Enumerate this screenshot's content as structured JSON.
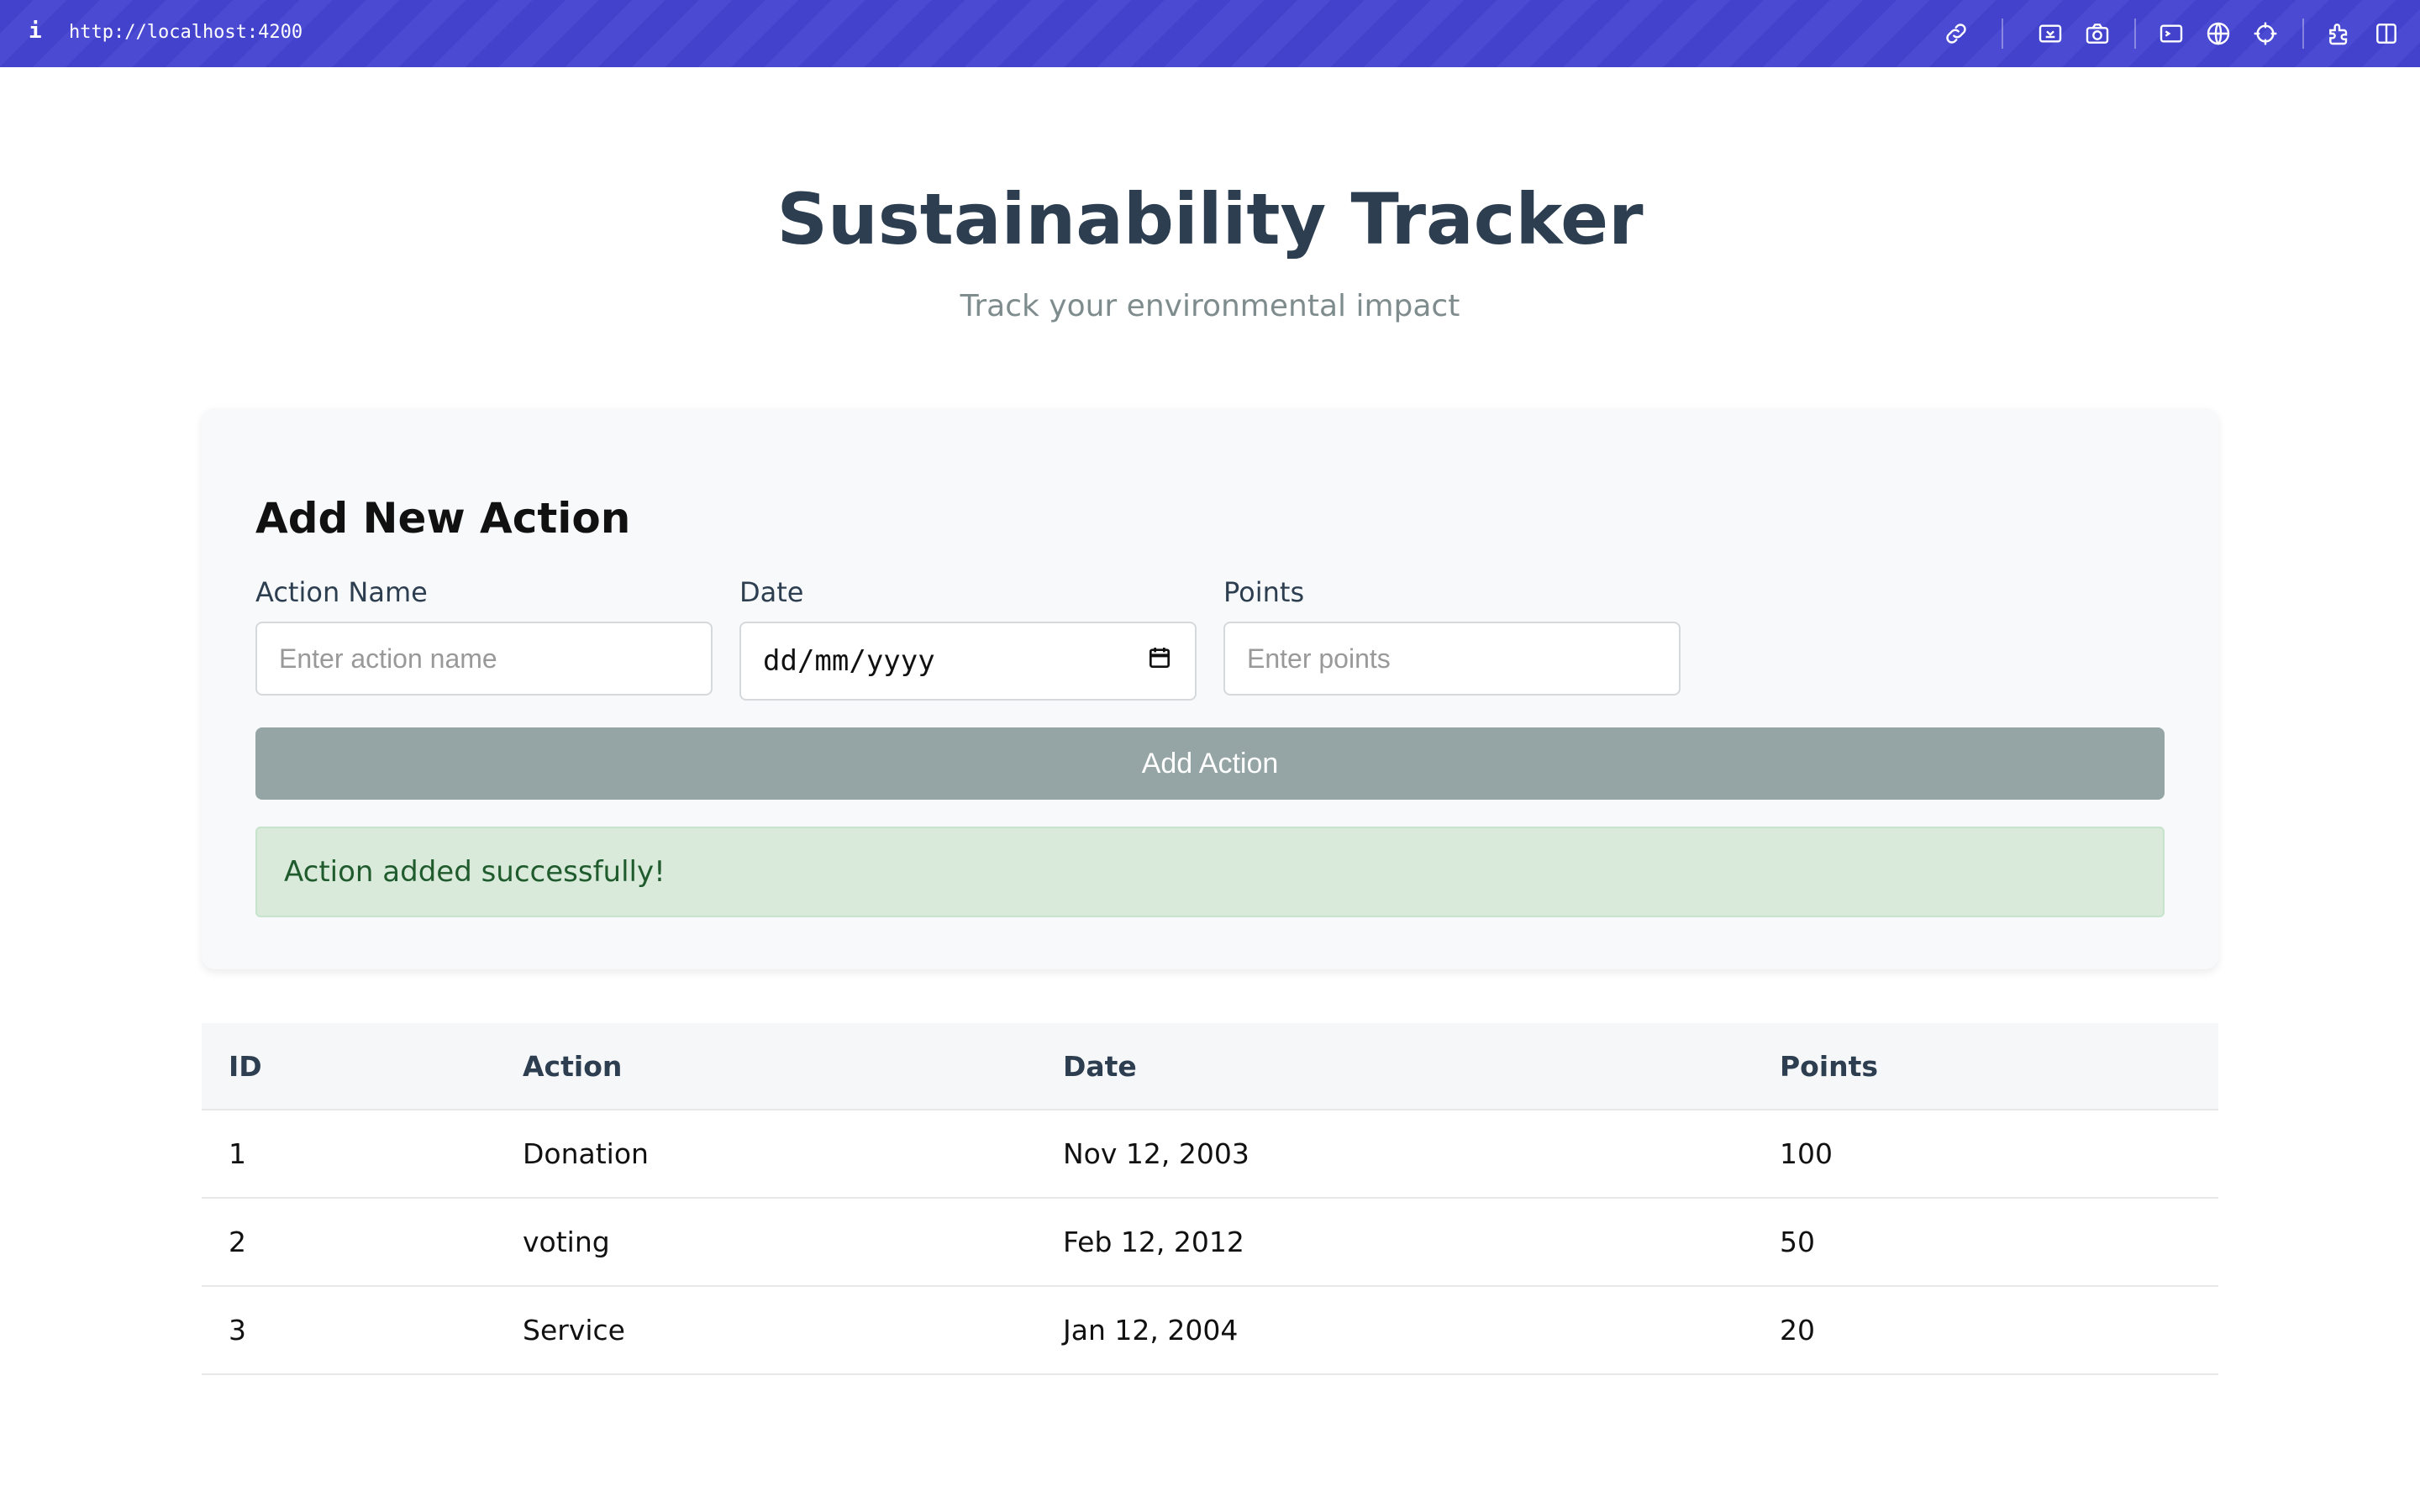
{
  "browser": {
    "info_glyph": "i",
    "url": "http://localhost:4200",
    "toolbar_icons": [
      "link-icon",
      "inspect-icon",
      "camera-icon",
      "terminal-icon",
      "globe-icon",
      "crosshair-icon",
      "extension-icon",
      "sidebar-icon"
    ]
  },
  "header": {
    "title": "Sustainability Tracker",
    "subtitle": "Track your environmental impact"
  },
  "form": {
    "title": "Add New Action",
    "action_name_label": "Action Name",
    "action_name_placeholder": "Enter action name",
    "date_label": "Date",
    "date_placeholder": "dd/mm/yyyy",
    "points_label": "Points",
    "points_placeholder": "Enter points",
    "submit_label": "Add Action",
    "success_message": "Action added successfully!"
  },
  "table": {
    "columns": [
      "ID",
      "Action",
      "Date",
      "Points"
    ],
    "rows": [
      [
        "1",
        "Donation",
        "Nov 12, 2003",
        "100"
      ],
      [
        "2",
        "voting",
        "Feb 12, 2012",
        "50"
      ],
      [
        "3",
        "Service",
        "Jan 12, 2004",
        "20"
      ]
    ]
  },
  "colors": {
    "toolbar": "#4242cc",
    "title": "#2c3e50",
    "subtitle": "#7f8c8d",
    "button": "#95a5a6",
    "success_bg": "#d9eadb",
    "success_text": "#1f5b2c"
  }
}
